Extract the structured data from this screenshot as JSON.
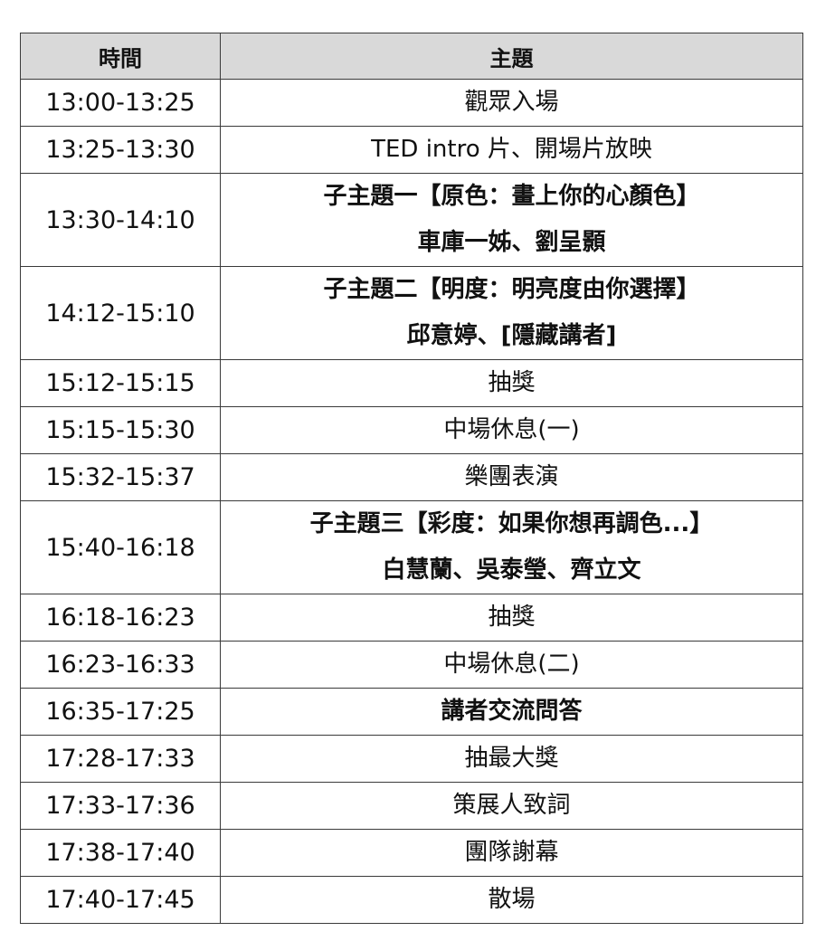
{
  "table": {
    "headers": {
      "time": "時間",
      "topic": "主題"
    },
    "rows": [
      {
        "time": "13:00-13:25",
        "lines": [
          "觀眾入場"
        ],
        "bold": false
      },
      {
        "time": "13:25-13:30",
        "lines": [
          "TED intro 片、開場片放映"
        ],
        "bold": false
      },
      {
        "time": "13:30-14:10",
        "lines": [
          "子主題一【原色：畫上你的心顏色】",
          "車庫一姊、劉呈顥"
        ],
        "bold": true
      },
      {
        "time": "14:12-15:10",
        "lines": [
          "子主題二【明度：明亮度由你選擇】",
          "邱意婷、[隱藏講者]"
        ],
        "bold": true
      },
      {
        "time": "15:12-15:15",
        "lines": [
          "抽獎"
        ],
        "bold": false
      },
      {
        "time": "15:15-15:30",
        "lines": [
          "中場休息(一)"
        ],
        "bold": false
      },
      {
        "time": "15:32-15:37",
        "lines": [
          "樂團表演"
        ],
        "bold": false
      },
      {
        "time": "15:40-16:18",
        "lines": [
          "子主題三【彩度：如果你想再調色...】",
          "白慧蘭、吳泰瑩、齊立文"
        ],
        "bold": true
      },
      {
        "time": "16:18-16:23",
        "lines": [
          "抽獎"
        ],
        "bold": false
      },
      {
        "time": "16:23-16:33",
        "lines": [
          "中場休息(二)"
        ],
        "bold": false
      },
      {
        "time": "16:35-17:25",
        "lines": [
          "講者交流問答"
        ],
        "bold": true
      },
      {
        "time": "17:28-17:33",
        "lines": [
          "抽最大獎"
        ],
        "bold": false
      },
      {
        "time": "17:33-17:36",
        "lines": [
          "策展人致詞"
        ],
        "bold": false
      },
      {
        "time": "17:38-17:40",
        "lines": [
          "團隊謝幕"
        ],
        "bold": false
      },
      {
        "time": "17:40-17:45",
        "lines": [
          "散場"
        ],
        "bold": false
      }
    ]
  },
  "colors": {
    "header_bg": "#d9d9d9",
    "border": "#3a3a3a",
    "text": "#111111"
  }
}
